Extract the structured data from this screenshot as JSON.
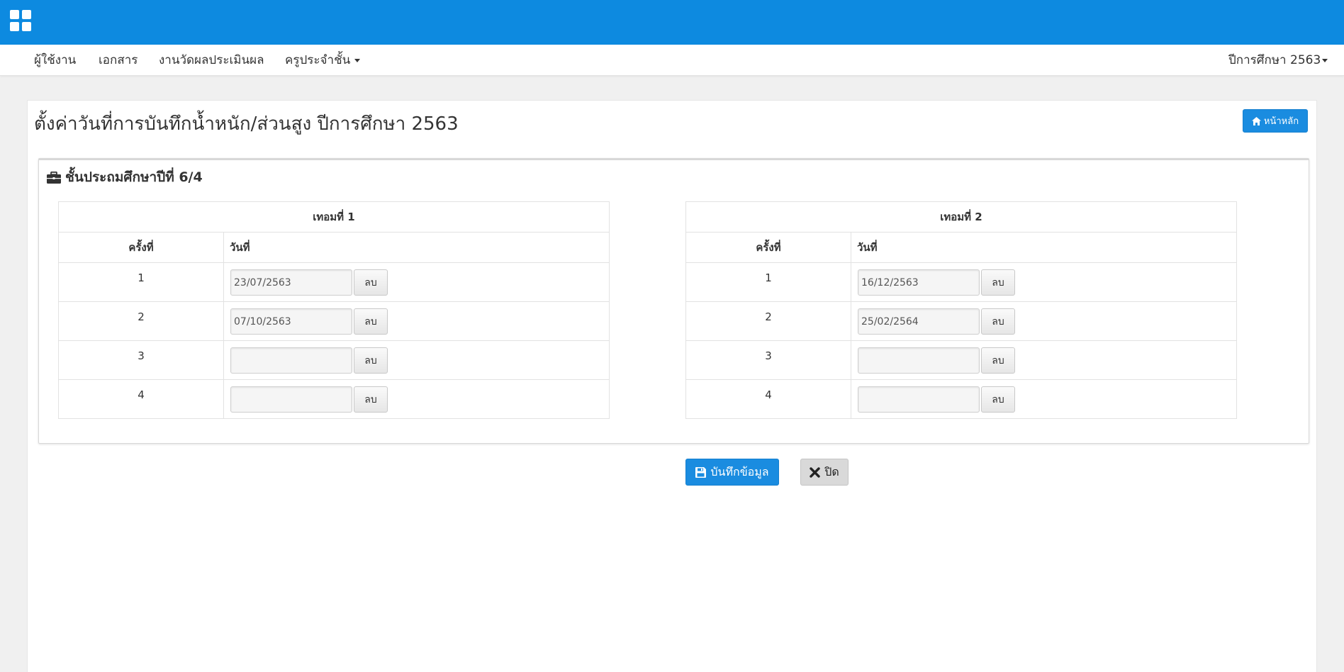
{
  "header": {
    "apps_icon": "grid-icon",
    "accent_color": "#0d8ae0"
  },
  "nav": {
    "items": [
      {
        "label": "ผู้ใช้งาน"
      },
      {
        "label": "เอกสาร"
      },
      {
        "label": "งานวัดผลประเมินผล"
      },
      {
        "label": "ครูประจำชั้น"
      }
    ],
    "year_selector": "ปีการศึกษา 2563"
  },
  "page": {
    "title": "ตั้งค่าวันที่การบันทึกน้ำหนัก/ส่วนสูง ปีการศึกษา 2563",
    "home_button": "หน้าหลัก",
    "home_icon": "home-icon"
  },
  "class_panel": {
    "title": "ชั้นประถมศึกษาปีที่ 6/4",
    "icon": "briefcase-icon"
  },
  "terms": [
    {
      "title": "เทอมที่ 1",
      "col_round": "ครั้งที่",
      "col_date": "วันที่",
      "rows": [
        {
          "round": "1",
          "date": "23/07/2563",
          "delete_label": "ลบ"
        },
        {
          "round": "2",
          "date": "07/10/2563",
          "delete_label": "ลบ"
        },
        {
          "round": "3",
          "date": "",
          "delete_label": "ลบ"
        },
        {
          "round": "4",
          "date": "",
          "delete_label": "ลบ"
        }
      ]
    },
    {
      "title": "เทอมที่ 2",
      "col_round": "ครั้งที่",
      "col_date": "วันที่",
      "rows": [
        {
          "round": "1",
          "date": "16/12/2563",
          "delete_label": "ลบ"
        },
        {
          "round": "2",
          "date": "25/02/2564",
          "delete_label": "ลบ"
        },
        {
          "round": "3",
          "date": "",
          "delete_label": "ลบ"
        },
        {
          "round": "4",
          "date": "",
          "delete_label": "ลบ"
        }
      ]
    }
  ],
  "actions": {
    "save_label": "บันทึกข้อมูล",
    "save_icon": "floppy-disk-icon",
    "close_label": "ปิด",
    "close_icon": "x-icon"
  }
}
